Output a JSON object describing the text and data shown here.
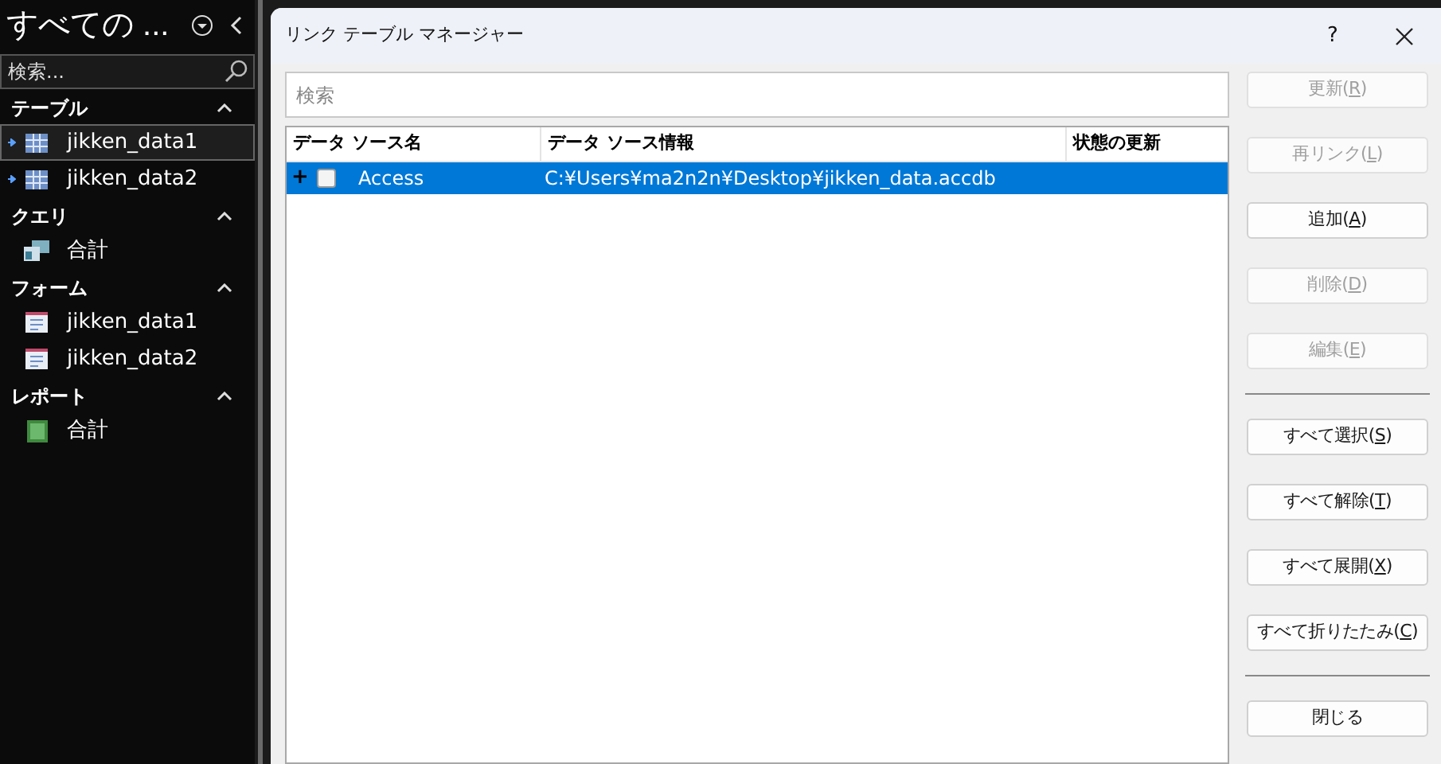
{
  "nav": {
    "title": "すべての ...",
    "search": {
      "placeholder": "検索..."
    },
    "groups": [
      {
        "title": "テーブル",
        "expanded": true,
        "items": [
          {
            "kind": "table",
            "label": "jikken_data1",
            "selected": true,
            "linked": true
          },
          {
            "kind": "table",
            "label": "jikken_data2",
            "selected": false,
            "linked": true
          }
        ]
      },
      {
        "title": "クエリ",
        "expanded": true,
        "items": [
          {
            "kind": "query",
            "label": "合計",
            "selected": false
          }
        ]
      },
      {
        "title": "フォーム",
        "expanded": true,
        "items": [
          {
            "kind": "form",
            "label": "jikken_data1",
            "selected": false
          },
          {
            "kind": "form",
            "label": "jikken_data2",
            "selected": false
          }
        ]
      },
      {
        "title": "レポート",
        "expanded": true,
        "items": [
          {
            "kind": "report",
            "label": "合計",
            "selected": false
          }
        ]
      }
    ]
  },
  "dialog": {
    "title": "リンク テーブル マネージャー",
    "help": "?",
    "search": {
      "placeholder": "検索"
    },
    "table": {
      "columns": [
        "データ ソース名",
        "データ ソース情報",
        "状態の更新"
      ],
      "rows": [
        {
          "expander": "+",
          "checked": false,
          "selected": true,
          "cells": [
            "Access",
            "C:¥Users¥ma2n2n¥Desktop¥jikken_data.accdb"
          ]
        }
      ]
    },
    "button_groups": [
      [
        {
          "before": "更新(",
          "key": "R",
          "after": ")",
          "disabled": true
        },
        {
          "before": "再リンク(",
          "key": "L",
          "after": ")",
          "disabled": true
        },
        {
          "before": "追加(",
          "key": "A",
          "after": ")",
          "disabled": false
        },
        {
          "before": "削除(",
          "key": "D",
          "after": ")",
          "disabled": true
        },
        {
          "before": "編集(",
          "key": "E",
          "after": ")",
          "disabled": true
        }
      ],
      [
        {
          "before": "すべて選択(",
          "key": "S",
          "after": ")",
          "disabled": false
        },
        {
          "before": "すべて解除(",
          "key": "T",
          "after": ")",
          "disabled": false
        },
        {
          "before": "すべて展開(",
          "key": "X",
          "after": ")",
          "disabled": false
        },
        {
          "before": "すべて折りたたみ(",
          "key": "C",
          "after": ")",
          "disabled": false
        }
      ],
      [
        {
          "before": "閉じる",
          "disabled": false
        }
      ]
    ]
  }
}
